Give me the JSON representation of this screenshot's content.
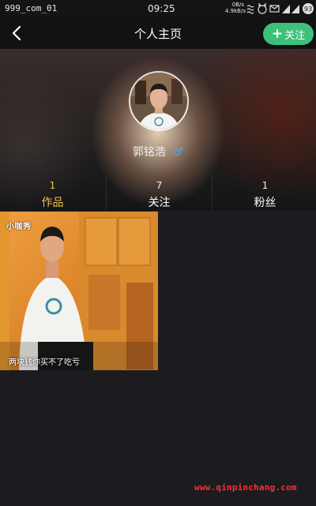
{
  "status_bar": {
    "carrier": "999_com_01",
    "time": "09:25",
    "speed_top": "0B/s",
    "speed_bottom": "4.9kB/s",
    "battery": "93"
  },
  "header": {
    "title": "个人主页",
    "follow_label": "关注",
    "follow_color": "#3ec07a"
  },
  "profile": {
    "username": "郭铭浩",
    "gender_symbol": "♂",
    "gender_color": "#4aa3ff"
  },
  "stats": [
    {
      "count": "1",
      "label": "作品",
      "active": true
    },
    {
      "count": "7",
      "label": "关注",
      "active": false
    },
    {
      "count": "1",
      "label": "粉丝",
      "active": false
    }
  ],
  "accent_color": "#f2c24a",
  "works": [
    {
      "logo_text": "小咖秀",
      "caption": "两块钱你买不了吃亏"
    }
  ],
  "watermark": "www.qinpinchang.com"
}
